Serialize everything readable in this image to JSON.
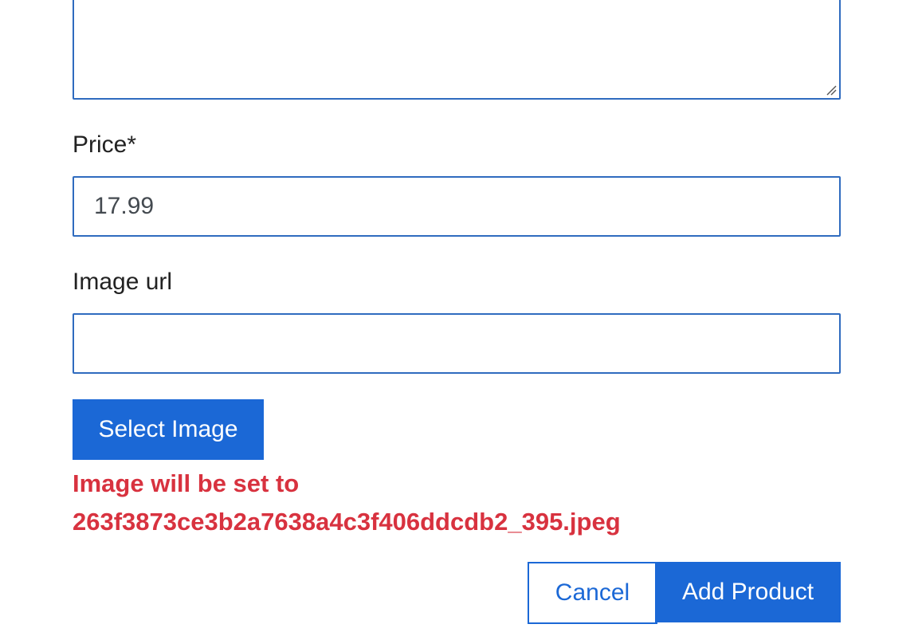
{
  "form": {
    "description_field": {
      "value": "",
      "resize_icon": "resize-grip-icon"
    },
    "price": {
      "label": "Price*",
      "value": "17.99"
    },
    "image_url": {
      "label": "Image url",
      "value": ""
    },
    "select_image_label": "Select Image",
    "image_notice": {
      "line1": "Image will be set to",
      "line2": "263f3873ce3b2a7638a4c3f406ddcdb2_395.jpeg"
    },
    "actions": {
      "cancel_label": "Cancel",
      "submit_label": "Add Product"
    }
  },
  "colors": {
    "primary": "#1b68d6",
    "field_border": "#2f6bbf",
    "error_text": "#d8323f",
    "label_text": "#222222"
  }
}
